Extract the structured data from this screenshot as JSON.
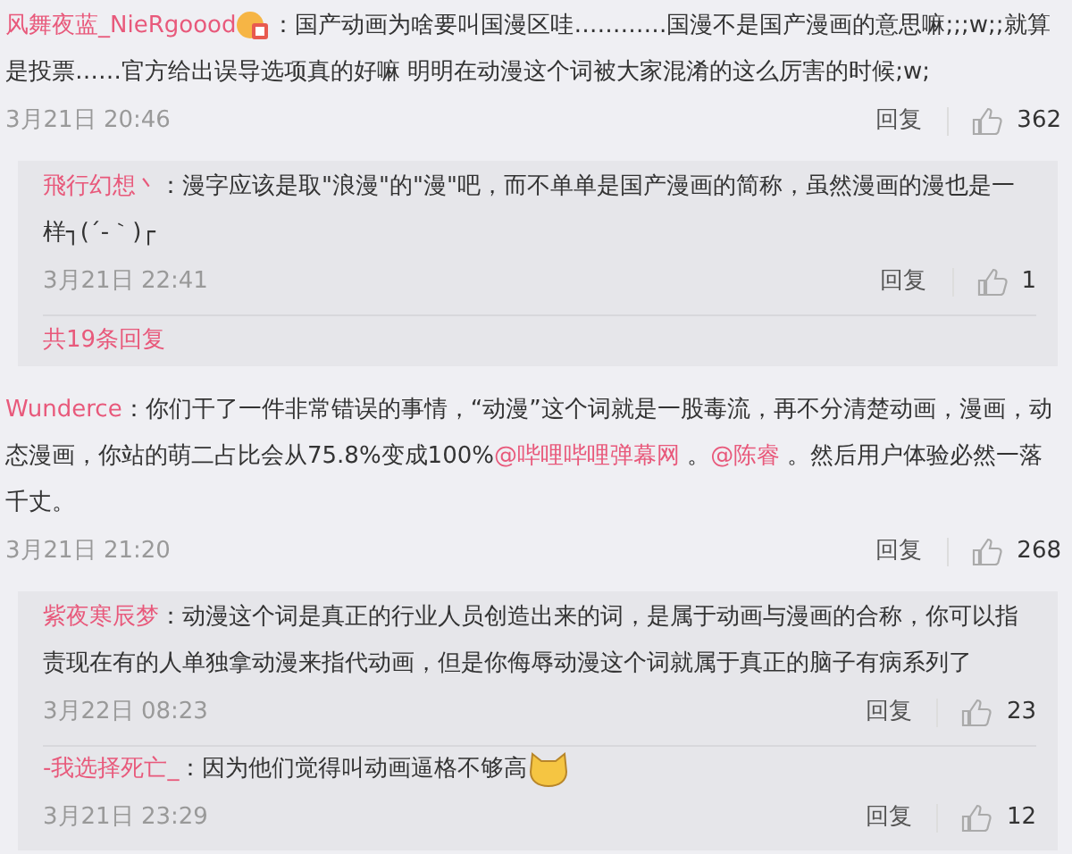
{
  "comments": [
    {
      "user": "风舞夜蓝_NieRgoood",
      "segments": [
        {
          "kind": "badge"
        },
        {
          "kind": "separator",
          "text": "："
        },
        {
          "kind": "text",
          "text": "国产动画为啥要叫国漫区哇…………国漫不是国产漫画的意思嘛;;;w;;就算是投票……官方给出误导选项真的好嘛 明明在动漫这个词被大家混淆的这么厉害的时候;w;"
        }
      ],
      "time": "3月21日 20:46",
      "reply": "回复",
      "likes": "362",
      "replies": [
        {
          "user": "飛行幻想丶",
          "segments": [
            {
              "kind": "separator",
              "text": "："
            },
            {
              "kind": "text",
              "text": "漫字应该是取\"浪漫\"的\"漫\"吧，而不单单是国产漫画的简称，虽然漫画的漫也是一样┐(´-｀)┌"
            }
          ],
          "time": "3月21日 22:41",
          "reply": "回复",
          "likes": "1"
        }
      ],
      "more": "共19条回复"
    },
    {
      "user": "Wunderce",
      "segments": [
        {
          "kind": "separator",
          "text": "："
        },
        {
          "kind": "text",
          "text": "你们干了一件非常错误的事情，“动漫”这个词就是一股毒流，再不分清楚动画，漫画，动态漫画，你站的萌二占比会从75.8%变成100%"
        },
        {
          "kind": "mention",
          "text": "@哔哩哔哩弹幕网"
        },
        {
          "kind": "text",
          "text": " 。"
        },
        {
          "kind": "mention",
          "text": "@陈睿"
        },
        {
          "kind": "text",
          "text": " 。然后用户体验必然一落千丈。"
        }
      ],
      "time": "3月21日 21:20",
      "reply": "回复",
      "likes": "268",
      "replies": [
        {
          "user": "紫夜寒辰梦",
          "segments": [
            {
              "kind": "separator",
              "text": "："
            },
            {
              "kind": "text",
              "text": "动漫这个词是真正的行业人员创造出来的词，是属于动画与漫画的合称，你可以指责现在有的人单独拿动漫来指代动画，但是你侮辱动漫这个词就属于真正的脑子有病系列了"
            }
          ],
          "time": "3月22日 08:23",
          "reply": "回复",
          "likes": "23"
        },
        {
          "user": "-我选择死亡_",
          "segments": [
            {
              "kind": "separator",
              "text": "："
            },
            {
              "kind": "text",
              "text": "因为他们觉得叫动画逼格不够高"
            },
            {
              "kind": "emoji"
            }
          ],
          "time": "3月21日 23:29",
          "reply": "回复",
          "likes": "12"
        }
      ]
    }
  ]
}
